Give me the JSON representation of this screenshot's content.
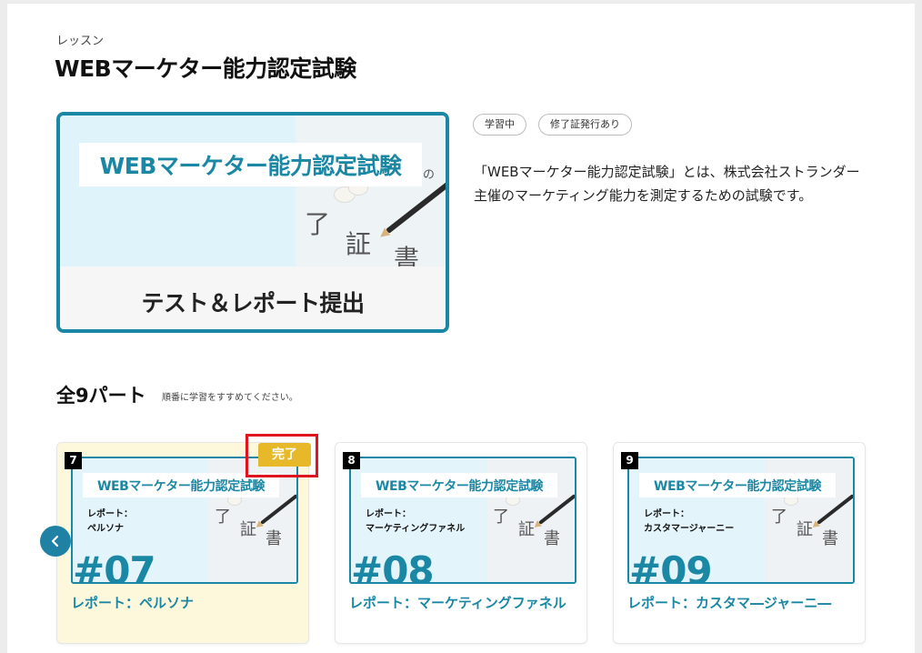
{
  "header": {
    "eyebrow": "レッスン",
    "title": "WEBマーケター能力認定試験"
  },
  "hero": {
    "image_title": "WEBマーケター能力認定試験",
    "image_subtitle": "テスト＆レポート提出",
    "paper_glyphs": [
      "了",
      "証",
      "書",
      "の"
    ]
  },
  "tags": [
    "学習中",
    "修了証発行あり"
  ],
  "description": "「WEBマーケター能力認定試験」とは、株式会社ストランダー主催のマーケティング能力を測定するための試験です。",
  "parts_section": {
    "title": "全9パート",
    "note": "順番に学習をすすめてください。"
  },
  "cards": [
    {
      "number": "7",
      "thumb_title": "WEBマーケター能力認定試験",
      "thumb_line1": "レポート：",
      "thumb_line2": "ペルソナ",
      "thumb_num": "#07",
      "title": "レポート：ペルソナ",
      "status": "完了"
    },
    {
      "number": "8",
      "thumb_title": "WEBマーケター能力認定試験",
      "thumb_line1": "レポート：",
      "thumb_line2": "マーケティングファネル",
      "thumb_num": "#08",
      "title": "レポート：マーケティングファネル"
    },
    {
      "number": "9",
      "thumb_title": "WEBマーケター能力認定試験",
      "thumb_line1": "レポート：",
      "thumb_line2": "カスタマージャーニー",
      "thumb_num": "#09",
      "title": "レポート：カスタマ―ジャーニ―"
    }
  ],
  "colors": {
    "accent": "#1a87a4",
    "done_badge": "#e8b82b",
    "done_card_bg": "#fdf8dc",
    "highlight_frame": "#e0141e"
  },
  "icons": {
    "prev": "chevron-left-icon"
  }
}
